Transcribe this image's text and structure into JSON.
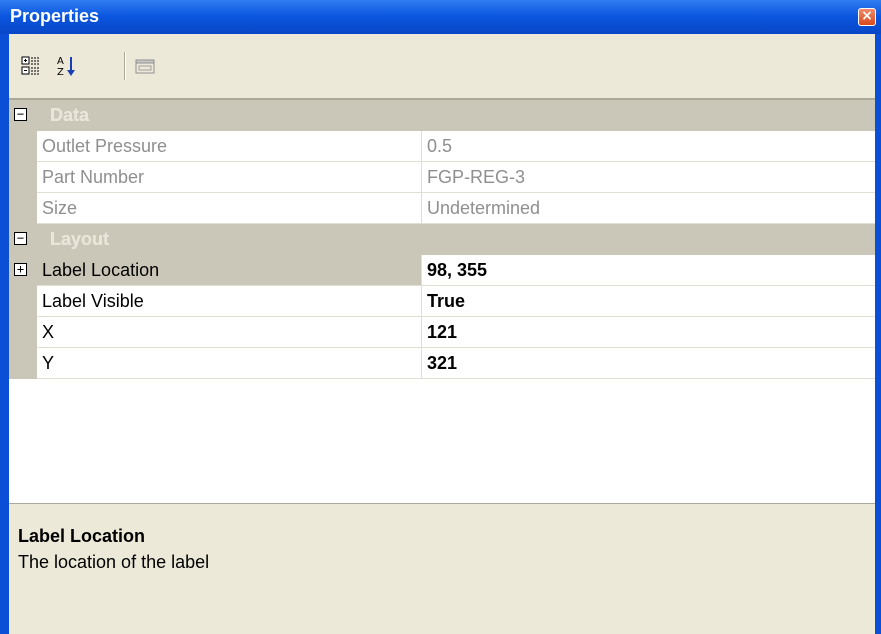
{
  "window": {
    "title": "Properties",
    "close_label": "×"
  },
  "toolbar": {
    "buttons": [
      {
        "icon": "categorized-icon"
      },
      {
        "icon": "alphabetical-sort-icon"
      },
      {
        "icon": "property-pages-icon"
      }
    ]
  },
  "grid": {
    "categories": [
      {
        "label": "Data",
        "expander": "−",
        "properties": [
          {
            "name": "Outlet Pressure",
            "value": "0.5"
          },
          {
            "name": "Part Number",
            "value": "FGP-REG-3"
          },
          {
            "name": "Size",
            "value": "Undetermined"
          }
        ]
      },
      {
        "label": "Layout",
        "expander": "−",
        "properties": [
          {
            "name": "Label Location",
            "value": "98, 355",
            "expander": "+"
          },
          {
            "name": "Label Visible",
            "value": "True"
          },
          {
            "name": "X",
            "value": "121"
          },
          {
            "name": "Y",
            "value": "321"
          }
        ]
      }
    ]
  },
  "description": {
    "title": "Label Location",
    "text": "The location of the label"
  },
  "colors": {
    "titlebar": "#0a55de",
    "category_bg": "#cbc7b8",
    "disabled_text": "#8f8f8f",
    "panel_bg": "#ece9d8"
  }
}
